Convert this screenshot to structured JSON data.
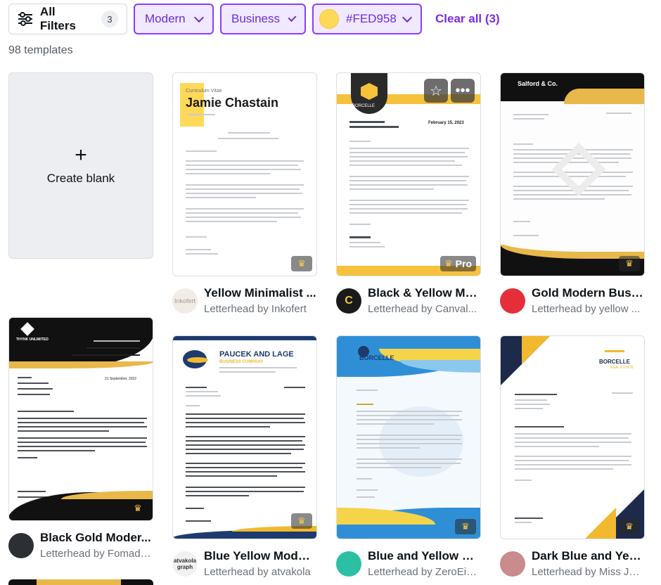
{
  "filters": {
    "all_filters": {
      "label": "All Filters",
      "count": "3",
      "icon": "sliders-icon"
    },
    "chips": [
      {
        "label": "Modern"
      },
      {
        "label": "Business"
      },
      {
        "label": "#FED958",
        "swatch": "#FED958"
      }
    ],
    "clear_all": "Clear all (3)"
  },
  "result_count": "98 templates",
  "create_blank": {
    "label": "Create blank",
    "icon": "plus-icon"
  },
  "templates": [
    {
      "title": "Yellow Minimalist ...",
      "subtitle": "Letterhead by Inkofert",
      "avatar_text": "Inkofert",
      "doc_name": "Jamie Chastain",
      "doc_tag": "Curriculum Vitae",
      "badge": ""
    },
    {
      "title": "Black & Yellow Mo...",
      "subtitle": "Letterhead by Canval...",
      "avatar_text": "C",
      "doc_name": "BORCELLE",
      "doc_date": "February 15, 2023",
      "badge": "Pro"
    },
    {
      "title": "Gold Modern Busi...",
      "subtitle": "Letterhead by yellow ...",
      "avatar_text": "",
      "doc_name": "Salford & Co.",
      "badge": ""
    },
    {
      "title": "Black Gold Moder...",
      "subtitle": "Letterhead by Fomadil...",
      "avatar_text": "",
      "doc_name": "THYNK UNLIMITED",
      "doc_date": "21 September, 2022",
      "badge": ""
    },
    {
      "title": "Blue Yellow Moder...",
      "subtitle": "Letterhead by atvakola",
      "avatar_text": "atvakola graph",
      "doc_name": "PAUCEK AND LAGE",
      "doc_tag": "BUSINESS COMPANY",
      "badge": ""
    },
    {
      "title": "Blue and Yellow M...",
      "subtitle": "Letterhead by ZeroEig...",
      "avatar_text": "",
      "doc_name": "BORCELLE",
      "badge": ""
    },
    {
      "title": "Dark Blue and Yell...",
      "subtitle": "Letterhead by Miss Jel...",
      "avatar_text": "",
      "doc_name": "BORCELLE",
      "doc_tag": "REAL ESTATE",
      "badge": ""
    }
  ],
  "colors": {
    "accent": "#8b3dff",
    "yellow": "#FED958",
    "gold": "#f2b92e",
    "navy": "#1d3b6f"
  }
}
